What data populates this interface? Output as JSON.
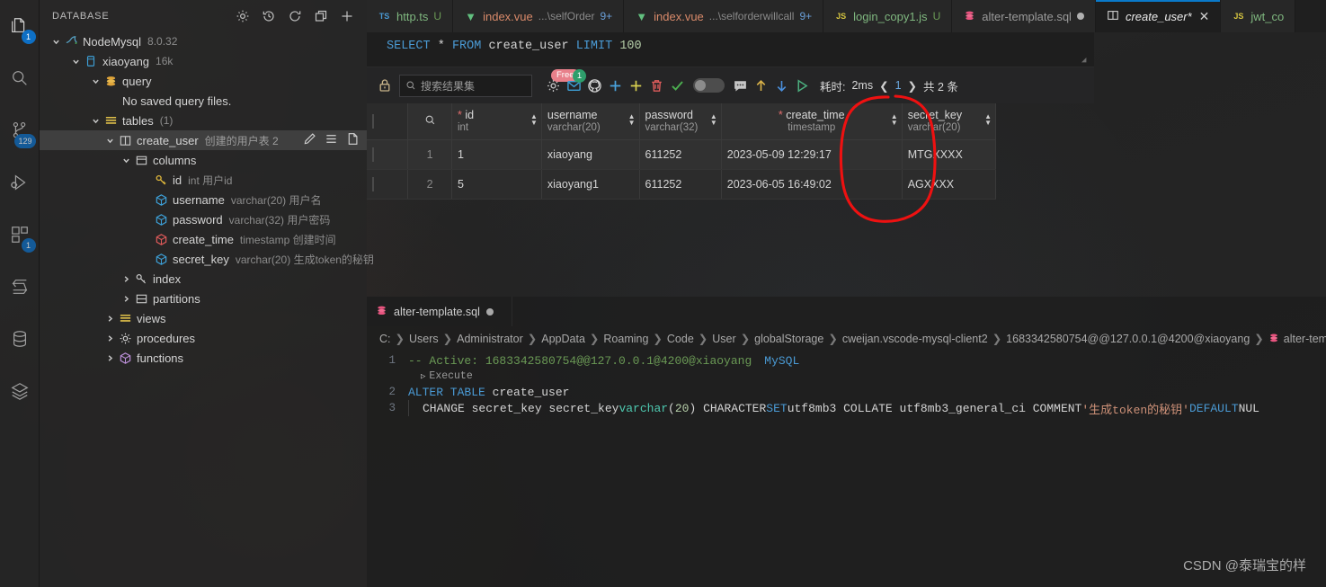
{
  "activitybar": {
    "items": [
      {
        "name": "explorer",
        "icon": "files-icon",
        "badge": "1"
      },
      {
        "name": "search",
        "icon": "search-icon",
        "badge": ""
      },
      {
        "name": "source-control",
        "icon": "source-control-icon",
        "badge": "129"
      },
      {
        "name": "run-debug",
        "icon": "run-debug-icon",
        "badge": ""
      },
      {
        "name": "extensions",
        "icon": "extensions-icon",
        "badge": "1"
      },
      {
        "name": "settings-sync",
        "icon": "s-logo-icon",
        "badge": ""
      },
      {
        "name": "database",
        "icon": "database-icon",
        "badge": ""
      },
      {
        "name": "layers",
        "icon": "layers-icon",
        "badge": ""
      }
    ]
  },
  "sidebar": {
    "title": "DATABASE",
    "actions": [
      {
        "name": "settings",
        "icon": "gear-icon"
      },
      {
        "name": "history",
        "icon": "history-icon"
      },
      {
        "name": "refresh",
        "icon": "refresh-icon"
      },
      {
        "name": "collapse-all",
        "icon": "collapse-all-icon"
      },
      {
        "name": "add-connection",
        "icon": "plus-icon"
      }
    ],
    "tree": [
      {
        "id": "conn",
        "label": "NodeMysql",
        "meta": "8.0.32",
        "indent": 0,
        "icon": "mysql-dolphin-icon",
        "twisty": "down"
      },
      {
        "id": "db",
        "label": "xiaoyang",
        "meta": "16k",
        "indent": 1,
        "icon": "db-icon",
        "twisty": "down"
      },
      {
        "id": "query",
        "label": "query",
        "meta": "",
        "indent": 2,
        "icon": "query-stack-icon",
        "twisty": "down"
      },
      {
        "id": "noquery",
        "label": "No saved query files.",
        "meta": "",
        "indent": 3,
        "icon": "none",
        "twisty": "none"
      },
      {
        "id": "tables",
        "label": "tables",
        "meta": "(1)",
        "indent": 2,
        "icon": "tables-icon",
        "twisty": "down"
      },
      {
        "id": "createuser",
        "label": "create_user",
        "desc": "创建的用户表 2",
        "indent": 3,
        "icon": "table-icon",
        "twisty": "down",
        "selected": true,
        "actions": [
          {
            "name": "edit-table",
            "icon": "pencil-icon"
          },
          {
            "name": "table-menu",
            "icon": "list-icon"
          },
          {
            "name": "new-query",
            "icon": "file-icon"
          }
        ]
      },
      {
        "id": "columns",
        "label": "columns",
        "meta": "",
        "indent": 4,
        "icon": "columns-icon",
        "twisty": "down"
      },
      {
        "id": "col-id",
        "label": "id",
        "meta": "int 用户id",
        "indent": 5,
        "icon": "key-icon",
        "twisty": "none"
      },
      {
        "id": "col-username",
        "label": "username",
        "meta": "varchar(20) 用户名",
        "indent": 5,
        "icon": "cube-blue-icon",
        "twisty": "none"
      },
      {
        "id": "col-password",
        "label": "password",
        "meta": "varchar(32) 用户密码",
        "indent": 5,
        "icon": "cube-blue-icon",
        "twisty": "none"
      },
      {
        "id": "col-createtime",
        "label": "create_time",
        "meta": "timestamp 创建时间",
        "indent": 5,
        "icon": "cube-red-icon",
        "twisty": "none"
      },
      {
        "id": "col-secretkey",
        "label": "secret_key",
        "meta": "varchar(20) 生成token的秘钥",
        "indent": 5,
        "icon": "cube-blue-icon",
        "twisty": "none"
      },
      {
        "id": "index",
        "label": "index",
        "meta": "",
        "indent": 4,
        "icon": "key-icon",
        "twisty": "right"
      },
      {
        "id": "partitions",
        "label": "partitions",
        "meta": "",
        "indent": 4,
        "icon": "partition-icon",
        "twisty": "right"
      },
      {
        "id": "views",
        "label": "views",
        "meta": "",
        "indent": 3,
        "icon": "tables-icon",
        "twisty": "right"
      },
      {
        "id": "procedures",
        "label": "procedures",
        "meta": "",
        "indent": 3,
        "icon": "gear-icon",
        "twisty": "right"
      },
      {
        "id": "functions",
        "label": "functions",
        "meta": "",
        "indent": 3,
        "icon": "cube-purple-icon",
        "twisty": "right"
      }
    ]
  },
  "tabs": [
    {
      "name": "http.ts",
      "sub": "",
      "flag": "U",
      "kind": "ts",
      "nine": "",
      "active": false,
      "dirty": false
    },
    {
      "name": "index.vue",
      "sub": "...\\selfOrder",
      "flag": "",
      "kind": "vue",
      "nine": "9+",
      "active": false,
      "dirty": false
    },
    {
      "name": "index.vue",
      "sub": "...\\selforderwillcall",
      "flag": "",
      "kind": "vue",
      "nine": "9+",
      "active": false,
      "dirty": false
    },
    {
      "name": "login_copy1.js",
      "sub": "",
      "flag": "U",
      "kind": "js",
      "nine": "",
      "active": false,
      "dirty": false
    },
    {
      "name": "alter-template.sql",
      "sub": "",
      "flag": "",
      "kind": "sql",
      "nine": "",
      "active": false,
      "dirty": true
    },
    {
      "name": "create_user*",
      "sub": "",
      "flag": "",
      "kind": "table",
      "nine": "",
      "active": true,
      "close": "✕"
    },
    {
      "name": "jwt_co",
      "sub": "",
      "flag": "",
      "kind": "js",
      "nine": "",
      "active": false,
      "dirty": false
    }
  ],
  "sql_strip": {
    "keyword1": "SELECT",
    "star": "*",
    "keyword2": "FROM",
    "table": "create_user",
    "keyword3": "LIMIT",
    "limit": "100"
  },
  "result_toolbar": {
    "lock_icon": "lock-icon",
    "search_placeholder": "搜索结果集",
    "search_value": "",
    "free_badge": "Free",
    "mail_badge": "1",
    "buttons": [
      {
        "name": "settings",
        "icon": "gear-icon"
      },
      {
        "name": "mail",
        "icon": "mail-icon"
      },
      {
        "name": "github",
        "icon": "github-icon"
      },
      {
        "name": "add-row",
        "icon": "plus-blue-icon"
      },
      {
        "name": "add-column",
        "icon": "plus-yellow-icon"
      },
      {
        "name": "delete-row",
        "icon": "trash-icon"
      },
      {
        "name": "confirm",
        "icon": "check-icon"
      },
      {
        "name": "toggle-edit",
        "icon": "toggle-icon"
      },
      {
        "name": "comment",
        "icon": "comment-icon"
      },
      {
        "name": "export-up",
        "icon": "arrow-up-icon"
      },
      {
        "name": "import-down",
        "icon": "arrow-down-icon"
      },
      {
        "name": "run",
        "icon": "play-icon"
      }
    ],
    "elapsed_label": "耗时:",
    "elapsed_value": "2ms",
    "prev": "❮",
    "page": "1",
    "next": "❯",
    "total": "共 2 条"
  },
  "grid": {
    "columns": [
      {
        "name": "id",
        "type": "int",
        "pk": true
      },
      {
        "name": "username",
        "type": "varchar(20)",
        "pk": false
      },
      {
        "name": "password",
        "type": "varchar(32)",
        "pk": false
      },
      {
        "name": "create_time",
        "type": "timestamp",
        "pk": true
      },
      {
        "name": "secret_key",
        "type": "varchar(20)",
        "pk": false
      }
    ],
    "rows": [
      {
        "index": "1",
        "id": "1",
        "username": "xiaoyang",
        "password": "611252",
        "create_time": "2023-05-09 12:29:17",
        "secret_key": "MTGXXXX"
      },
      {
        "index": "2",
        "id": "5",
        "username": "xiaoyang1",
        "password": "611252",
        "create_time": "2023-06-05 16:49:02",
        "secret_key": "AGXXXX"
      }
    ]
  },
  "annotation": {
    "color": "#ee1111",
    "shape": "hand-drawn-circle",
    "target": "secret_key-column"
  },
  "bottom": {
    "tab_label": "alter-template.sql",
    "breadcrumb": [
      "C:",
      "Users",
      "Administrator",
      "AppData",
      "Roaming",
      "Code",
      "User",
      "globalStorage",
      "cweijan.vscode-mysql-client2",
      "1683342580754@@127.0.0.1@4200@xiaoyang",
      "alter-templa"
    ],
    "codelens": "Execute",
    "lines": [
      {
        "no": "1",
        "kind": "active",
        "comment": "-- Active: 1683342580754@@127.0.0.1@4200@xiaoyang",
        "dialect": "MySQL"
      },
      {
        "no": "2",
        "kind": "alter",
        "kw": "ALTER TABLE",
        "ident": "create_user"
      },
      {
        "no": "3",
        "kind": "change",
        "text": "CHANGE secret_key secret_key varchar(20) CHARACTER SET utf8mb3 COLLATE utf8mb3_general_ci COMMENT '生成token的秘钥' DEFAULT NUL"
      }
    ]
  },
  "watermark": "CSDN @泰瑞宝的样"
}
